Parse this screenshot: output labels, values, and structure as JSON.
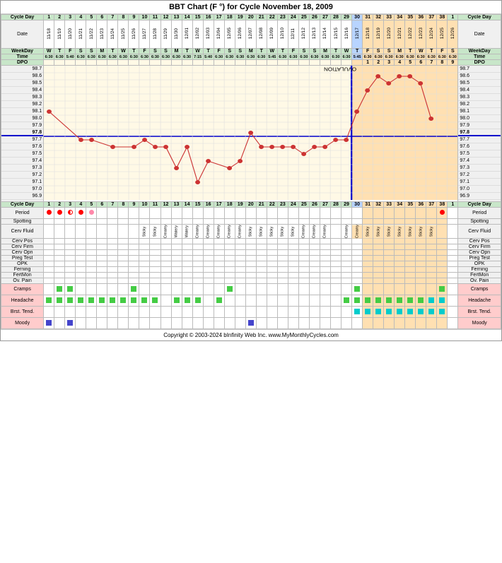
{
  "title": "BBT Chart (F °) for Cycle November 18, 2009",
  "footer": "Copyright © 2003-2024 bInfinity Web Inc.   www.MyMonthlyCycles.com",
  "labels": {
    "cycle_day": "Cycle Day",
    "date": "Date",
    "weekday": "WeekDay",
    "time": "Time",
    "dpo": "DPO",
    "period": "Period",
    "spotting": "Spotting",
    "cerv_fluid": "Cerv Fluid",
    "cerv_pos": "Cerv Pos",
    "cerv_firm": "Cerv Firm",
    "cerv_opn": "Cerv Opn",
    "preg_test": "Preg Test",
    "opk": "OPK",
    "ferning": "Ferning",
    "fertmon": "FertMon",
    "ov_pain": "Ov. Pain",
    "cramps": "Cramps",
    "headache": "Headache",
    "brst_tend": "Brst. Tend.",
    "moody": "Moody"
  },
  "temp_labels": [
    "98.7",
    "98.6",
    "98.5",
    "98.4",
    "98.3",
    "98.2",
    "98.1",
    "98.0",
    "97.9",
    "97.8",
    "97.7",
    "97.6",
    "97.5",
    "97.4",
    "97.3",
    "97.2",
    "97.1",
    "97.0",
    "96.9"
  ],
  "cycle_days_pre": [
    1,
    2,
    3,
    4,
    5,
    6,
    7,
    8,
    9,
    10,
    11,
    12,
    13,
    14,
    15,
    16,
    17,
    18,
    19,
    20,
    21,
    22,
    23,
    24,
    25,
    26,
    27,
    28,
    29
  ],
  "ovulation_day": 29,
  "cycle_days_post": [
    30,
    31,
    32,
    33,
    34,
    35,
    36,
    37,
    38,
    1
  ],
  "dates_pre": [
    "11/18",
    "11/19",
    "11/20",
    "11/21",
    "11/22",
    "11/23",
    "11/24",
    "11/25",
    "11/26",
    "11/27",
    "11/28",
    "11/29",
    "11/30",
    "12/01",
    "12/02",
    "12/03",
    "12/04",
    "12/05",
    "12/06",
    "12/07",
    "12/08",
    "12/09",
    "12/10",
    "12/11",
    "12/12",
    "12/13",
    "12/14",
    "12/15",
    "12/16"
  ],
  "dates_post": [
    "12/17",
    "12/18",
    "12/19",
    "12/20",
    "12/21",
    "12/22",
    "12/23",
    "12/24",
    "12/25",
    "12/26"
  ],
  "weekdays_pre": [
    "W",
    "T",
    "F",
    "S",
    "S",
    "M",
    "T",
    "W",
    "T",
    "F",
    "S",
    "S",
    "M",
    "T",
    "W",
    "T",
    "F",
    "S",
    "S",
    "M",
    "T",
    "W",
    "T",
    "F",
    "S",
    "S",
    "M",
    "T",
    "W"
  ],
  "weekdays_post": [
    "T",
    "F",
    "S",
    "S",
    "M",
    "T",
    "W",
    "T",
    "F",
    "S"
  ],
  "times_pre": [
    "6:30",
    "6:30",
    "5:40",
    "6:30",
    "6:30",
    "6:30",
    "6:30",
    "6:30",
    "6:30",
    "6:30",
    "6:30",
    "6:30",
    "6:30",
    "6:30",
    "7:15",
    "5:40",
    "6:30",
    "6:30",
    "6:30",
    "6:30",
    "6:30",
    "5:45",
    "6:30",
    "6:30",
    "6:30",
    "6:30",
    "6:30",
    "6:30",
    "6:30"
  ],
  "times_post": [
    "5:45",
    "6:30",
    "6:30",
    "6:30",
    "6:30",
    "6:30",
    "6:30",
    "6:30",
    "6:30",
    "6:30"
  ],
  "dpo_post": [
    1,
    2,
    3,
    4,
    5,
    6,
    7,
    8,
    9
  ],
  "temperatures": {
    "1": 98.1,
    "2": null,
    "3": null,
    "4": 97.7,
    "5": 97.7,
    "6": null,
    "7": 97.6,
    "8": null,
    "9": 97.6,
    "10": 97.7,
    "11": 97.6,
    "12": 97.6,
    "13": 97.3,
    "14": 97.6,
    "15": 97.1,
    "16": 97.4,
    "17": null,
    "18": 97.3,
    "19": 97.4,
    "20": 97.8,
    "21": 97.6,
    "22": 97.6,
    "23": 97.6,
    "24": 97.6,
    "25": 97.5,
    "26": 97.6,
    "27": 97.6,
    "28": 97.7,
    "29": 97.7,
    "30": 98.1,
    "31": 98.4,
    "32": 98.6,
    "33": 98.5,
    "34": 98.6,
    "35": 98.6,
    "36": 98.5,
    "37": 98.0,
    "38": null
  },
  "cover_line": 97.8,
  "period_days": [
    1,
    2,
    4,
    5,
    38
  ],
  "period_half": [
    3
  ],
  "cramps_days": [
    2,
    3,
    9,
    18,
    30,
    38
  ],
  "headache_days": [
    1,
    2,
    3,
    4,
    5,
    6,
    7,
    8,
    9,
    10,
    11,
    13,
    14,
    15,
    17,
    29,
    30,
    31,
    32,
    33,
    34,
    35,
    36,
    37,
    38
  ],
  "brst_tend_days": [
    30,
    31,
    32,
    33,
    34,
    35,
    36,
    37,
    38
  ],
  "moody_days": [
    1,
    3,
    20
  ],
  "cerv_fluid": {
    "10": "Sticky",
    "11": "Sticky",
    "12": "Creamy",
    "13": "Watery",
    "14": "Watery",
    "15": "Creamy",
    "16": "Creamy",
    "17": "Creamy",
    "18": "Creamy",
    "19": "Creamy",
    "20": "Sticky",
    "21": "Sticky",
    "22": "Sticky",
    "23": "Sticky",
    "24": "Sticky",
    "25": "Creamy",
    "26": "Creamy",
    "27": "Creamy",
    "29": "Creamy",
    "30": "Creamy",
    "31": "Sticky",
    "32": "Sticky",
    "33": "Sticky",
    "34": "Sticky",
    "35": "Sticky",
    "36": "Sticky",
    "37": "Sticky"
  },
  "colors": {
    "header_bg": "#c8e6c9",
    "pre_chart_bg": "#fff9e6",
    "post_chart_bg": "#ffe0b2",
    "ovulation_bg": "#b8d4ff",
    "cover_line_color": "#0000cc",
    "label_bg": "#f0f0f0"
  }
}
